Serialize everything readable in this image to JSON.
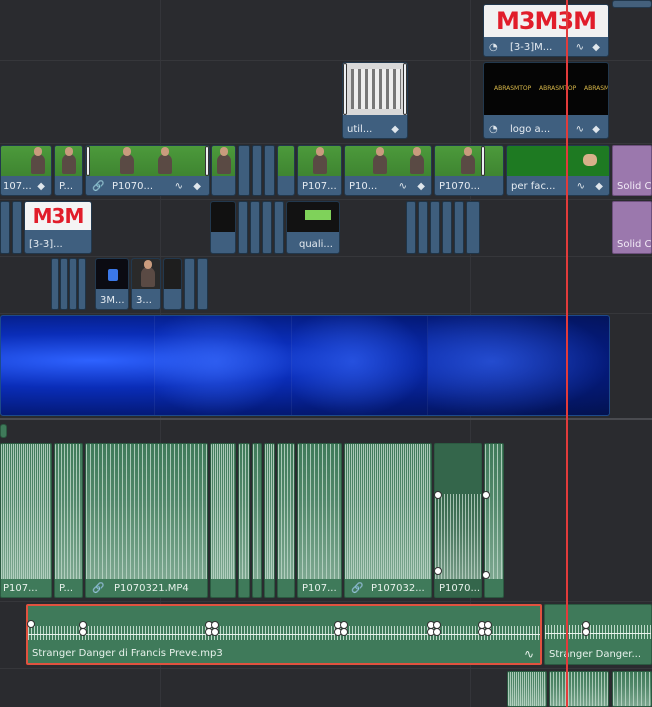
{
  "colors": {
    "background": "#2a2b2f",
    "video_clip": "#3f5f7f",
    "audio_clip": "#3f7a5a",
    "solid_clip": "#9b78ad",
    "playhead": "#e23b3b",
    "selection_border": "#e0523f"
  },
  "icons": [
    "gauge-icon",
    "link-icon",
    "curve-icon",
    "keyframe-diamond-icon"
  ],
  "tracks": {
    "v6": {
      "clip_label": "[3-3]M...",
      "logo_text": "M3M3M"
    },
    "v5": {
      "util_label": "util...",
      "logo_label": "logo a...",
      "logo_text": "ABRASMTOP"
    },
    "v4": {
      "clip1": "107...",
      "clip2": "P...",
      "clip3": "P1070...",
      "clip4": "P107...",
      "clip5": "P10...",
      "clip6": "P1070...",
      "clip7": "per fac...",
      "solid": "Solid C"
    },
    "v3": {
      "logo_label": "[3-3]...",
      "logo_text": "M3M",
      "quali_label": "quali...",
      "solid": "Solid C"
    },
    "v2": {
      "clip1": "3M...",
      "clip2": "3..."
    },
    "a1": {
      "clip1": "P107...",
      "clip2": "P...",
      "clip3": "P1070321.MP4",
      "clip4": "P107...",
      "clip5": "P107032...",
      "clip6": "P1070..."
    },
    "a2": {
      "clip1": "Stranger Danger di Francis Preve.mp3",
      "clip2": "Stranger Danger..."
    }
  }
}
